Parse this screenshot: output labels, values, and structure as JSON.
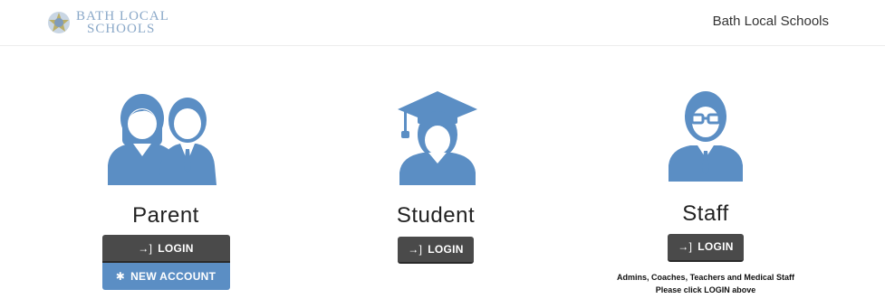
{
  "header": {
    "logo_line1": "BATH LOCAL",
    "logo_line2": "SCHOOLS",
    "site_title": "Bath Local Schools"
  },
  "roles": {
    "parent": {
      "title": "Parent",
      "login_label": "LOGIN",
      "new_account_label": "NEW ACCOUNT"
    },
    "student": {
      "title": "Student",
      "login_label": "LOGIN"
    },
    "staff": {
      "title": "Staff",
      "login_label": "LOGIN",
      "note_line1": "Admins, Coaches, Teachers and Medical Staff",
      "note_line2": "Please click LOGIN above"
    }
  },
  "icons": {
    "login": "sign-in-icon",
    "new_account": "asterisk-icon",
    "parent": "parents-avatar-icon",
    "student": "graduate-avatar-icon",
    "staff": "staff-avatar-icon"
  },
  "colors": {
    "avatar_blue": "#5b8ec4",
    "button_dark": "#4a4a4a",
    "button_blue": "#5b8ec4"
  }
}
